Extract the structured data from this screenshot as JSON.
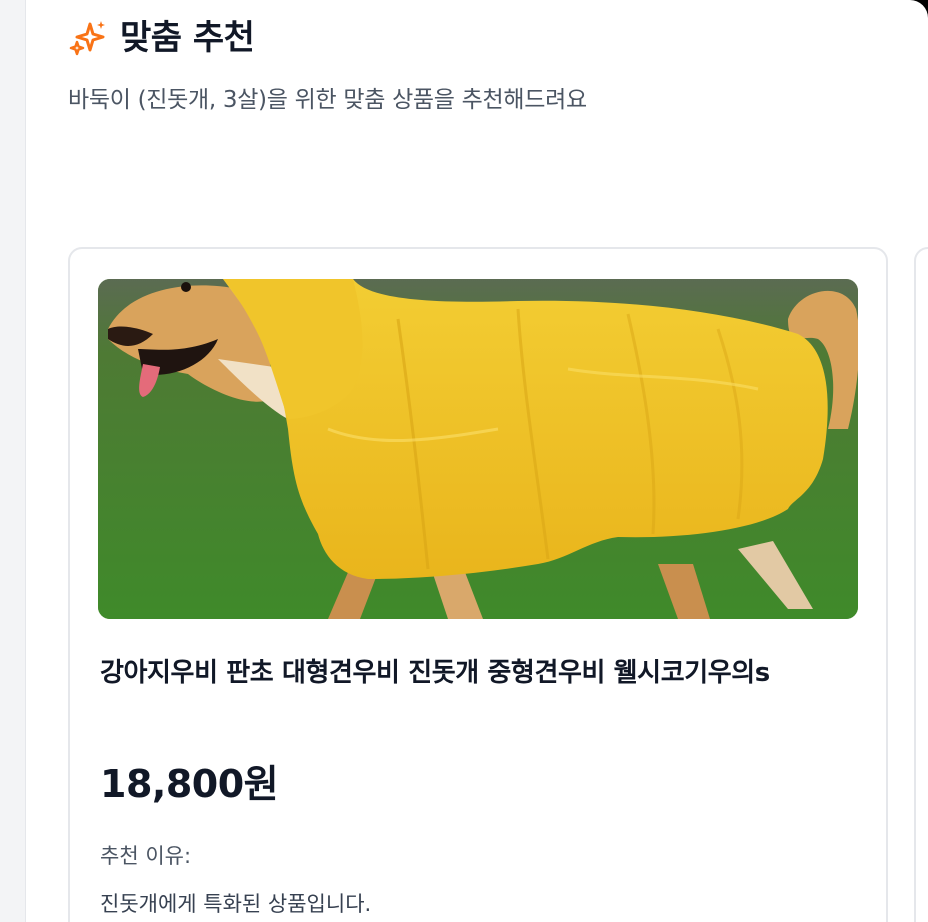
{
  "header": {
    "icon": "sparkle-icon",
    "title": "맞춤 추천",
    "subtitle": "바둑이 (진돗개, 3살)을 위한 맞춤 상품을 추천해드려요"
  },
  "colors": {
    "accent": "#f97316",
    "text_primary": "#111827",
    "text_secondary": "#4b5563"
  },
  "products": [
    {
      "image": "dog-in-yellow-raincoat",
      "name": "강아지우비 판초 대형견우비 진돗개 중형견우비 웰시코기우의s",
      "price": "18,800원",
      "reason_label": "추천 이유:",
      "reason": "진돗개에게 특화된 상품입니다."
    }
  ]
}
